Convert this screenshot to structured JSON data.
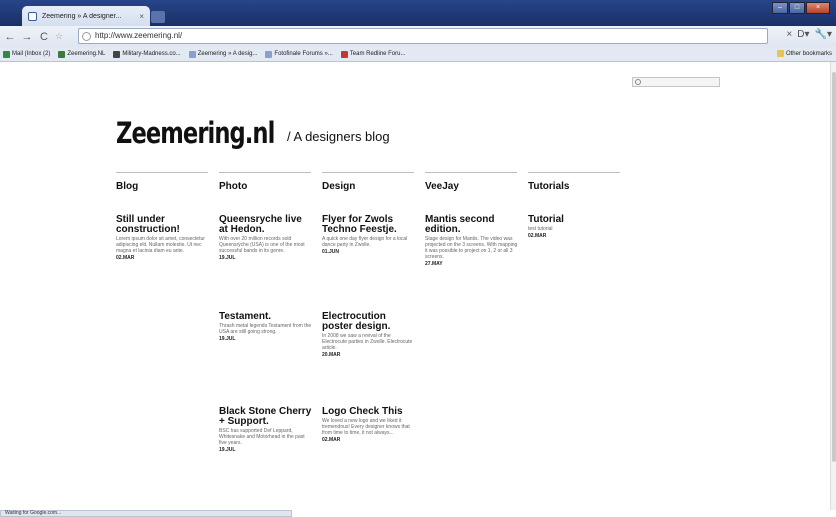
{
  "browser": {
    "tab_title": "Zeemering » A designer...",
    "tab_close": "×",
    "url": "http://www.zeemering.nl/",
    "nav": {
      "back": "←",
      "forward": "→",
      "reload": "C",
      "star": "☆"
    },
    "window_buttons": [
      "–",
      "□",
      "×"
    ],
    "toolbar_right": [
      "×",
      "D▾",
      "🔧▾"
    ],
    "bookmarks": [
      {
        "label": "Mail (Inbox (2)",
        "icon": "gmail-icon",
        "color": "#2d8a3e"
      },
      {
        "label": "Zeemering.NL",
        "icon": "site-icon",
        "color": "#3a7a3a"
      },
      {
        "label": "Military-Madness.co...",
        "icon": "globe-icon",
        "color": "#444"
      },
      {
        "label": "Zeemering » A desig...",
        "icon": "page-icon",
        "color": "#8aa0c8"
      },
      {
        "label": "Fotofinale Forums »...",
        "icon": "page-icon",
        "color": "#8aa0c8"
      },
      {
        "label": "Team Redline Foru...",
        "icon": "bird-icon",
        "color": "#c0392b"
      }
    ],
    "other_bookmarks": "Other bookmarks",
    "status": "Waiting for Google.com..."
  },
  "page": {
    "search_placeholder": "",
    "logo": "Zeemering.nl",
    "tagline": "/ A designers blog",
    "columns": [
      {
        "title": "Blog",
        "posts": [
          {
            "title": "Still under construction!",
            "excerpt": "Lorem ipsum dolor sit amet, consectetur adipiscing elit. Nullam molestie. Ut nec magna et lacinia diam eu ante.",
            "date": "02.MAR"
          }
        ]
      },
      {
        "title": "Photo",
        "posts": [
          {
            "title": "Queensryche live at Hedon.",
            "excerpt": "With over 20 million records sold Queensrÿche (USA) is one of the most successful bands in its genre.",
            "date": "19.JUL"
          },
          {
            "title": "Testament.",
            "excerpt": "Thrash metal legends Testament from the USA are still going strong.",
            "date": "19.JUL"
          },
          {
            "title": "Black Stone Cherry + Support.",
            "excerpt": "BSC has supported Def Leppard, Whitesnake and Motorhead in the past five years.",
            "date": "19.JUL"
          }
        ]
      },
      {
        "title": "Design",
        "posts": [
          {
            "title": "Flyer for Zwols Techno Feestje.",
            "excerpt": "A quick one day flyer design for a local dance party in Zwolle.",
            "date": "01.JUN"
          },
          {
            "title": "Electrocution poster design.",
            "excerpt": "In 2008 we saw a revival of the Electrocute parties in Zwolle. Electrocute article.",
            "date": "20.MAR"
          },
          {
            "title": "Logo Check This",
            "excerpt": "We loved a new logo and we liked it tremendous! Every designer knows that from time to time, it not always...",
            "date": "02.MAR"
          }
        ]
      },
      {
        "title": "VeeJay",
        "posts": [
          {
            "title": "Mantis second edition.",
            "excerpt": "Stage design for Mantis. The video was projected on the 3 screens. With mapping it was possible to project on 1, 2 or all 3 screens.",
            "date": "27.MAY"
          }
        ]
      },
      {
        "title": "Tutorials",
        "posts": [
          {
            "title": "Tutorial",
            "excerpt": "test tutorial",
            "date": "02.MAR"
          }
        ]
      }
    ]
  },
  "colors": {
    "titlebar": "#1f3a7a",
    "chrome_bg": "#e3e9f3",
    "page_bg": "#ffffff",
    "text": "#111111"
  }
}
